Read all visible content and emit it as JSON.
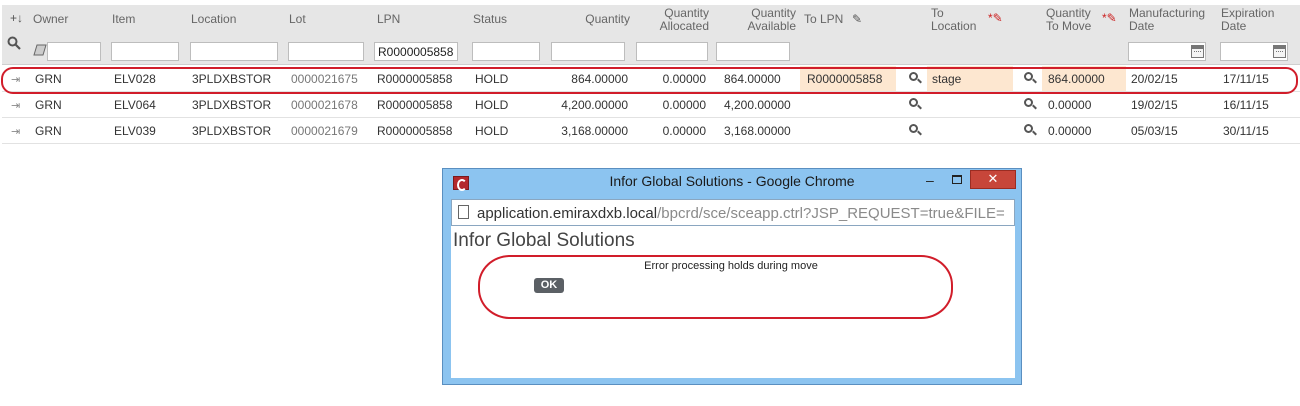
{
  "columns": {
    "owner": "Owner",
    "item": "Item",
    "location": "Location",
    "lot": "Lot",
    "lpn": "LPN",
    "status": "Status",
    "quantity": "Quantity",
    "qty_alloc_1": "Quantity",
    "qty_alloc_2": "Allocated",
    "qty_avail_1": "Quantity",
    "qty_avail_2": "Available",
    "to_lpn": "To LPN",
    "to_loc_1": "To",
    "to_loc_2": "Location",
    "qty_move_1": "Quantity",
    "qty_move_2": "To Move",
    "mfg_1": "Manufacturing",
    "mfg_2": "Date",
    "exp_1": "Expiration",
    "exp_2": "Date"
  },
  "filters": {
    "lpn": "R0000005858"
  },
  "rows": [
    {
      "owner": "GRN",
      "item": "ELV028",
      "location": "3PLDXBSTOR",
      "lot": "0000021675",
      "lpn": "R0000005858",
      "status": "HOLD",
      "quantity": "864.00000",
      "allocated": "0.00000",
      "available": "864.00000",
      "to_lpn": "R0000005858",
      "to_location": "stage",
      "to_move": "864.00000",
      "mfg_date": "20/02/15",
      "exp_date": "17/11/15"
    },
    {
      "owner": "GRN",
      "item": "ELV064",
      "location": "3PLDXBSTOR",
      "lot": "0000021678",
      "lpn": "R0000005858",
      "status": "HOLD",
      "quantity": "4,200.00000",
      "allocated": "0.00000",
      "available": "4,200.00000",
      "to_lpn": "",
      "to_location": "",
      "to_move": "0.00000",
      "mfg_date": "19/02/15",
      "exp_date": "16/11/15"
    },
    {
      "owner": "GRN",
      "item": "ELV039",
      "location": "3PLDXBSTOR",
      "lot": "0000021679",
      "lpn": "R0000005858",
      "status": "HOLD",
      "quantity": "3,168.00000",
      "allocated": "0.00000",
      "available": "3,168.00000",
      "to_lpn": "",
      "to_location": "",
      "to_move": "0.00000",
      "mfg_date": "05/03/15",
      "exp_date": "30/11/15"
    }
  ],
  "popup": {
    "title": "Infor Global Solutions - Google Chrome",
    "url_host": "application.emiraxdxb.local",
    "url_path": "/bpcrd/sce/sceapp.ctrl?JSP_REQUEST=true&FILE=",
    "page_title": "Infor Global Solutions",
    "message": "Error processing holds during move",
    "ok_label": "OK",
    "close_glyph": "✕",
    "minimize_glyph": "–"
  },
  "colors": {
    "highlight": "#fde7d0",
    "annotation_red": "#d11d2a",
    "chrome_frame": "#8cc4f0",
    "close_button": "#c7463a"
  }
}
